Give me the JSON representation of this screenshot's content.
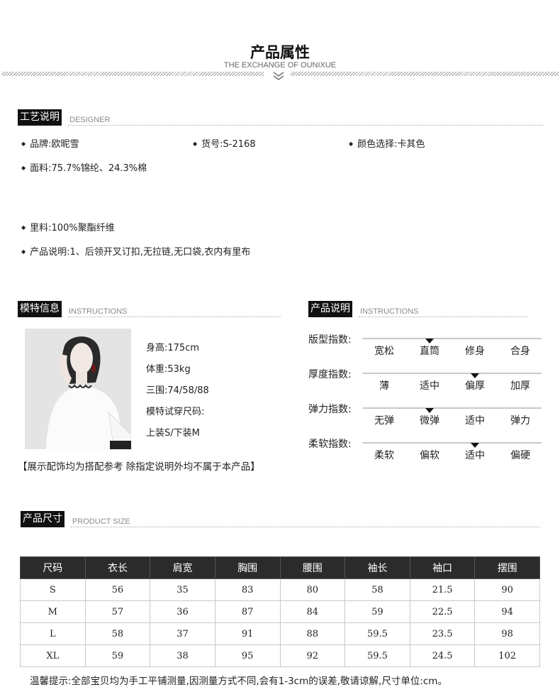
{
  "header": {
    "title": "产品属性",
    "subtitle": "THE EXCHANGE OF OUNIXUE"
  },
  "craft": {
    "tag": "工艺说明",
    "en": "DESIGNER",
    "brand": "品牌:欧昵雪",
    "item_no": "货号:S-2168",
    "color": "颜色选择:卡其色",
    "fabric": "面料:75.7%锦纶、24.3%棉",
    "lining": "里料:100%聚酯纤维",
    "desc": "产品说明:1、后领开叉订扣,无拉链,无口袋,衣内有里布"
  },
  "model": {
    "tag": "模特信息",
    "en": "INSTRUCTIONS",
    "height": "身高:175cm",
    "weight": "体重:53kg",
    "measurements": "三围:74/58/88",
    "size_label": "模特试穿尺码:",
    "size_value": "上装S/下装M",
    "disclaimer": "【展示配饰均为搭配参考 除指定说明外均不属于本产品】"
  },
  "product_desc": {
    "tag": "产品说明",
    "en": "INSTRUCTIONS",
    "indices": [
      {
        "label": "版型指数:",
        "options": [
          "宽松",
          "直筒",
          "修身",
          "合身"
        ],
        "selected": 1
      },
      {
        "label": "厚度指数:",
        "options": [
          "薄",
          "适中",
          "偏厚",
          "加厚"
        ],
        "selected": 2
      },
      {
        "label": "弹力指数:",
        "options": [
          "无弹",
          "微弹",
          "适中",
          "弹力"
        ],
        "selected": 1
      },
      {
        "label": "柔软指数:",
        "options": [
          "柔软",
          "偏软",
          "适中",
          "偏硬"
        ],
        "selected": 2
      }
    ]
  },
  "size": {
    "tag": "产品尺寸",
    "en": "PRODUCT SIZE",
    "headers": [
      "尺码",
      "衣长",
      "肩宽",
      "胸围",
      "腰围",
      "袖长",
      "袖口",
      "摆围"
    ],
    "rows": [
      [
        "S",
        "56",
        "35",
        "83",
        "80",
        "58",
        "21.5",
        "90"
      ],
      [
        "M",
        "57",
        "36",
        "87",
        "84",
        "59",
        "22.5",
        "94"
      ],
      [
        "L",
        "58",
        "37",
        "91",
        "88",
        "59.5",
        "23.5",
        "98"
      ],
      [
        "XL",
        "59",
        "38",
        "95",
        "92",
        "59.5",
        "24.5",
        "102"
      ]
    ],
    "tip": "温馨提示:全部宝贝均为手工平铺测量,因测量方式不同,会有1-3cm的误差,敬请谅解,尺寸单位:cm。"
  },
  "colors": {
    "dark": "#111111",
    "table_header": "#2b2b2b",
    "muted": "#8a8a8a"
  }
}
